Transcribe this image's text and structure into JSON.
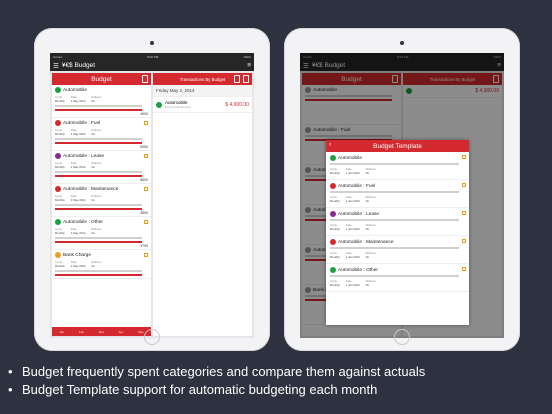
{
  "colors": {
    "accent": "#d42a2f",
    "background": "#2e3140"
  },
  "left_device": {
    "status": {
      "carrier": "Carrier",
      "time": "8:00 PM",
      "battery": "100%"
    },
    "nav_title": "¥€$ Budget",
    "budget_header": "Budget",
    "budget_items": [
      {
        "name": "Automobile",
        "icon_color": "#1aa043",
        "cycle_label": "Cycle",
        "cycle": "Monthly",
        "date_label": "Date",
        "date": "1 May 2014",
        "rollover_label": "Rollover",
        "rollover": "No",
        "amount": "4900"
      },
      {
        "name": "Automobile : Fuel",
        "icon_color": "#d42a2f",
        "cycle_label": "Cycle",
        "cycle": "Monthly",
        "date_label": "Date",
        "date": "1 May 2014",
        "rollover_label": "Rollover",
        "rollover": "No",
        "amount": "5250"
      },
      {
        "name": "Automobile : Lease",
        "icon_color": "#8a2a8f",
        "cycle_label": "Cycle",
        "cycle": "Monthly",
        "date_label": "Date",
        "date": "1 May 2014",
        "rollover_label": "Rollover",
        "rollover": "No",
        "amount": "5600"
      },
      {
        "name": "Automobile : Maintenance",
        "icon_color": "#d42a2f",
        "cycle_label": "Cycle",
        "cycle": "Monthly",
        "date_label": "Date",
        "date": "1 May 2014",
        "rollover_label": "Rollover",
        "rollover": "No",
        "amount": "3500"
      },
      {
        "name": "Automobile : Other",
        "icon_color": "#1aa043",
        "cycle_label": "Cycle",
        "cycle": "Monthly",
        "date_label": "Date",
        "date": "1 May 2014",
        "rollover_label": "Rollover",
        "rollover": "No",
        "amount": "3790"
      },
      {
        "name": "Bank Charge",
        "icon_color": "#e9a020",
        "cycle_label": "Cycle",
        "cycle": "Monthly",
        "date_label": "Date",
        "date": "1 May 2014",
        "rollover_label": "Rollover",
        "rollover": "No",
        "amount": ""
      }
    ],
    "tabs": [
      "Jan",
      "Feb",
      "Mar",
      "Apr",
      "May"
    ],
    "transactions_header": "Transactions By Budget",
    "transactions_date": "Friday May 2, 2014",
    "transaction": {
      "name": "Automobile",
      "sub": "From Credit account",
      "amount": "$ 4,900.00"
    }
  },
  "right_device": {
    "status": {
      "carrier": "Carrier",
      "time": "8:00 PM",
      "battery": "100%"
    },
    "nav_title": "¥€$ Budget",
    "budget_header": "Budget",
    "bg_items": [
      "Automobile",
      "Automobile : Fuel",
      "Automobile : Lease",
      "Automobile : Maintenance",
      "Automobile : Other",
      "Bank Charge"
    ],
    "transactions_header": "Transactions By Budget",
    "transaction_amount": "$ 4,900.00",
    "modal": {
      "title": "Budget Template",
      "items": [
        {
          "name": "Automobile",
          "icon_color": "#1aa043",
          "cycle_label": "Cycle",
          "cycle": "Monthly",
          "date_label": "Date",
          "date": "1 Jan 2013",
          "rollover_label": "Rollover",
          "rollover": "No"
        },
        {
          "name": "Automobile : Fuel",
          "icon_color": "#d42a2f",
          "cycle_label": "Cycle",
          "cycle": "Monthly",
          "date_label": "Date",
          "date": "1 Jan 2013",
          "rollover_label": "Rollover",
          "rollover": "No"
        },
        {
          "name": "Automobile : Lease",
          "icon_color": "#8a2a8f",
          "cycle_label": "Cycle",
          "cycle": "Monthly",
          "date_label": "Date",
          "date": "1 Jan 2013",
          "rollover_label": "Rollover",
          "rollover": "No"
        },
        {
          "name": "Automobile : Maintenance",
          "icon_color": "#d42a2f",
          "cycle_label": "Cycle",
          "cycle": "Monthly",
          "date_label": "Date",
          "date": "1 Jan 2013",
          "rollover_label": "Rollover",
          "rollover": "No"
        },
        {
          "name": "Automobile : Other",
          "icon_color": "#1aa043",
          "cycle_label": "Cycle",
          "cycle": "Monthly",
          "date_label": "Date",
          "date": "1 Jan 2013",
          "rollover_label": "Rollover",
          "rollover": "No"
        }
      ]
    }
  },
  "captions": [
    "Budget frequently spent categories and compare them against actuals",
    "Budget Template support for automatic budgeting each month"
  ]
}
